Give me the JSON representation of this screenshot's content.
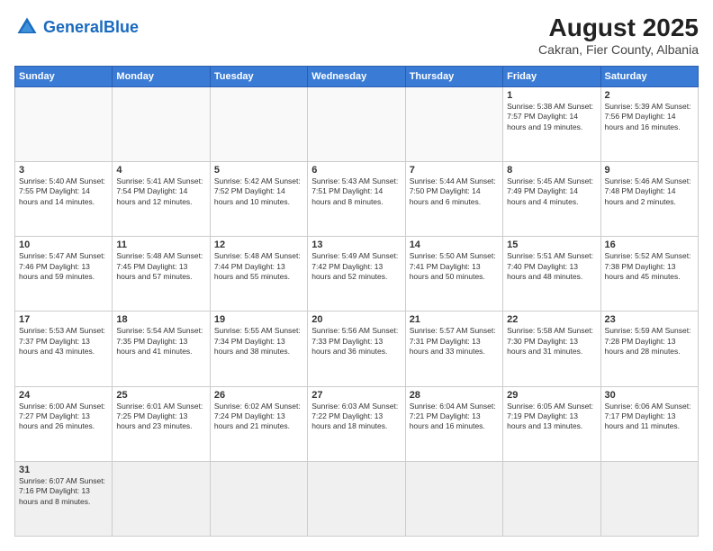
{
  "header": {
    "logo_general": "General",
    "logo_blue": "Blue",
    "title": "August 2025",
    "subtitle": "Cakran, Fier County, Albania"
  },
  "weekdays": [
    "Sunday",
    "Monday",
    "Tuesday",
    "Wednesday",
    "Thursday",
    "Friday",
    "Saturday"
  ],
  "weeks": [
    [
      {
        "day": "",
        "info": ""
      },
      {
        "day": "",
        "info": ""
      },
      {
        "day": "",
        "info": ""
      },
      {
        "day": "",
        "info": ""
      },
      {
        "day": "",
        "info": ""
      },
      {
        "day": "1",
        "info": "Sunrise: 5:38 AM\nSunset: 7:57 PM\nDaylight: 14 hours\nand 19 minutes."
      },
      {
        "day": "2",
        "info": "Sunrise: 5:39 AM\nSunset: 7:56 PM\nDaylight: 14 hours\nand 16 minutes."
      }
    ],
    [
      {
        "day": "3",
        "info": "Sunrise: 5:40 AM\nSunset: 7:55 PM\nDaylight: 14 hours\nand 14 minutes."
      },
      {
        "day": "4",
        "info": "Sunrise: 5:41 AM\nSunset: 7:54 PM\nDaylight: 14 hours\nand 12 minutes."
      },
      {
        "day": "5",
        "info": "Sunrise: 5:42 AM\nSunset: 7:52 PM\nDaylight: 14 hours\nand 10 minutes."
      },
      {
        "day": "6",
        "info": "Sunrise: 5:43 AM\nSunset: 7:51 PM\nDaylight: 14 hours\nand 8 minutes."
      },
      {
        "day": "7",
        "info": "Sunrise: 5:44 AM\nSunset: 7:50 PM\nDaylight: 14 hours\nand 6 minutes."
      },
      {
        "day": "8",
        "info": "Sunrise: 5:45 AM\nSunset: 7:49 PM\nDaylight: 14 hours\nand 4 minutes."
      },
      {
        "day": "9",
        "info": "Sunrise: 5:46 AM\nSunset: 7:48 PM\nDaylight: 14 hours\nand 2 minutes."
      }
    ],
    [
      {
        "day": "10",
        "info": "Sunrise: 5:47 AM\nSunset: 7:46 PM\nDaylight: 13 hours\nand 59 minutes."
      },
      {
        "day": "11",
        "info": "Sunrise: 5:48 AM\nSunset: 7:45 PM\nDaylight: 13 hours\nand 57 minutes."
      },
      {
        "day": "12",
        "info": "Sunrise: 5:48 AM\nSunset: 7:44 PM\nDaylight: 13 hours\nand 55 minutes."
      },
      {
        "day": "13",
        "info": "Sunrise: 5:49 AM\nSunset: 7:42 PM\nDaylight: 13 hours\nand 52 minutes."
      },
      {
        "day": "14",
        "info": "Sunrise: 5:50 AM\nSunset: 7:41 PM\nDaylight: 13 hours\nand 50 minutes."
      },
      {
        "day": "15",
        "info": "Sunrise: 5:51 AM\nSunset: 7:40 PM\nDaylight: 13 hours\nand 48 minutes."
      },
      {
        "day": "16",
        "info": "Sunrise: 5:52 AM\nSunset: 7:38 PM\nDaylight: 13 hours\nand 45 minutes."
      }
    ],
    [
      {
        "day": "17",
        "info": "Sunrise: 5:53 AM\nSunset: 7:37 PM\nDaylight: 13 hours\nand 43 minutes."
      },
      {
        "day": "18",
        "info": "Sunrise: 5:54 AM\nSunset: 7:35 PM\nDaylight: 13 hours\nand 41 minutes."
      },
      {
        "day": "19",
        "info": "Sunrise: 5:55 AM\nSunset: 7:34 PM\nDaylight: 13 hours\nand 38 minutes."
      },
      {
        "day": "20",
        "info": "Sunrise: 5:56 AM\nSunset: 7:33 PM\nDaylight: 13 hours\nand 36 minutes."
      },
      {
        "day": "21",
        "info": "Sunrise: 5:57 AM\nSunset: 7:31 PM\nDaylight: 13 hours\nand 33 minutes."
      },
      {
        "day": "22",
        "info": "Sunrise: 5:58 AM\nSunset: 7:30 PM\nDaylight: 13 hours\nand 31 minutes."
      },
      {
        "day": "23",
        "info": "Sunrise: 5:59 AM\nSunset: 7:28 PM\nDaylight: 13 hours\nand 28 minutes."
      }
    ],
    [
      {
        "day": "24",
        "info": "Sunrise: 6:00 AM\nSunset: 7:27 PM\nDaylight: 13 hours\nand 26 minutes."
      },
      {
        "day": "25",
        "info": "Sunrise: 6:01 AM\nSunset: 7:25 PM\nDaylight: 13 hours\nand 23 minutes."
      },
      {
        "day": "26",
        "info": "Sunrise: 6:02 AM\nSunset: 7:24 PM\nDaylight: 13 hours\nand 21 minutes."
      },
      {
        "day": "27",
        "info": "Sunrise: 6:03 AM\nSunset: 7:22 PM\nDaylight: 13 hours\nand 18 minutes."
      },
      {
        "day": "28",
        "info": "Sunrise: 6:04 AM\nSunset: 7:21 PM\nDaylight: 13 hours\nand 16 minutes."
      },
      {
        "day": "29",
        "info": "Sunrise: 6:05 AM\nSunset: 7:19 PM\nDaylight: 13 hours\nand 13 minutes."
      },
      {
        "day": "30",
        "info": "Sunrise: 6:06 AM\nSunset: 7:17 PM\nDaylight: 13 hours\nand 11 minutes."
      }
    ],
    [
      {
        "day": "31",
        "info": "Sunrise: 6:07 AM\nSunset: 7:16 PM\nDaylight: 13 hours\nand 8 minutes."
      },
      {
        "day": "",
        "info": ""
      },
      {
        "day": "",
        "info": ""
      },
      {
        "day": "",
        "info": ""
      },
      {
        "day": "",
        "info": ""
      },
      {
        "day": "",
        "info": ""
      },
      {
        "day": "",
        "info": ""
      }
    ]
  ]
}
